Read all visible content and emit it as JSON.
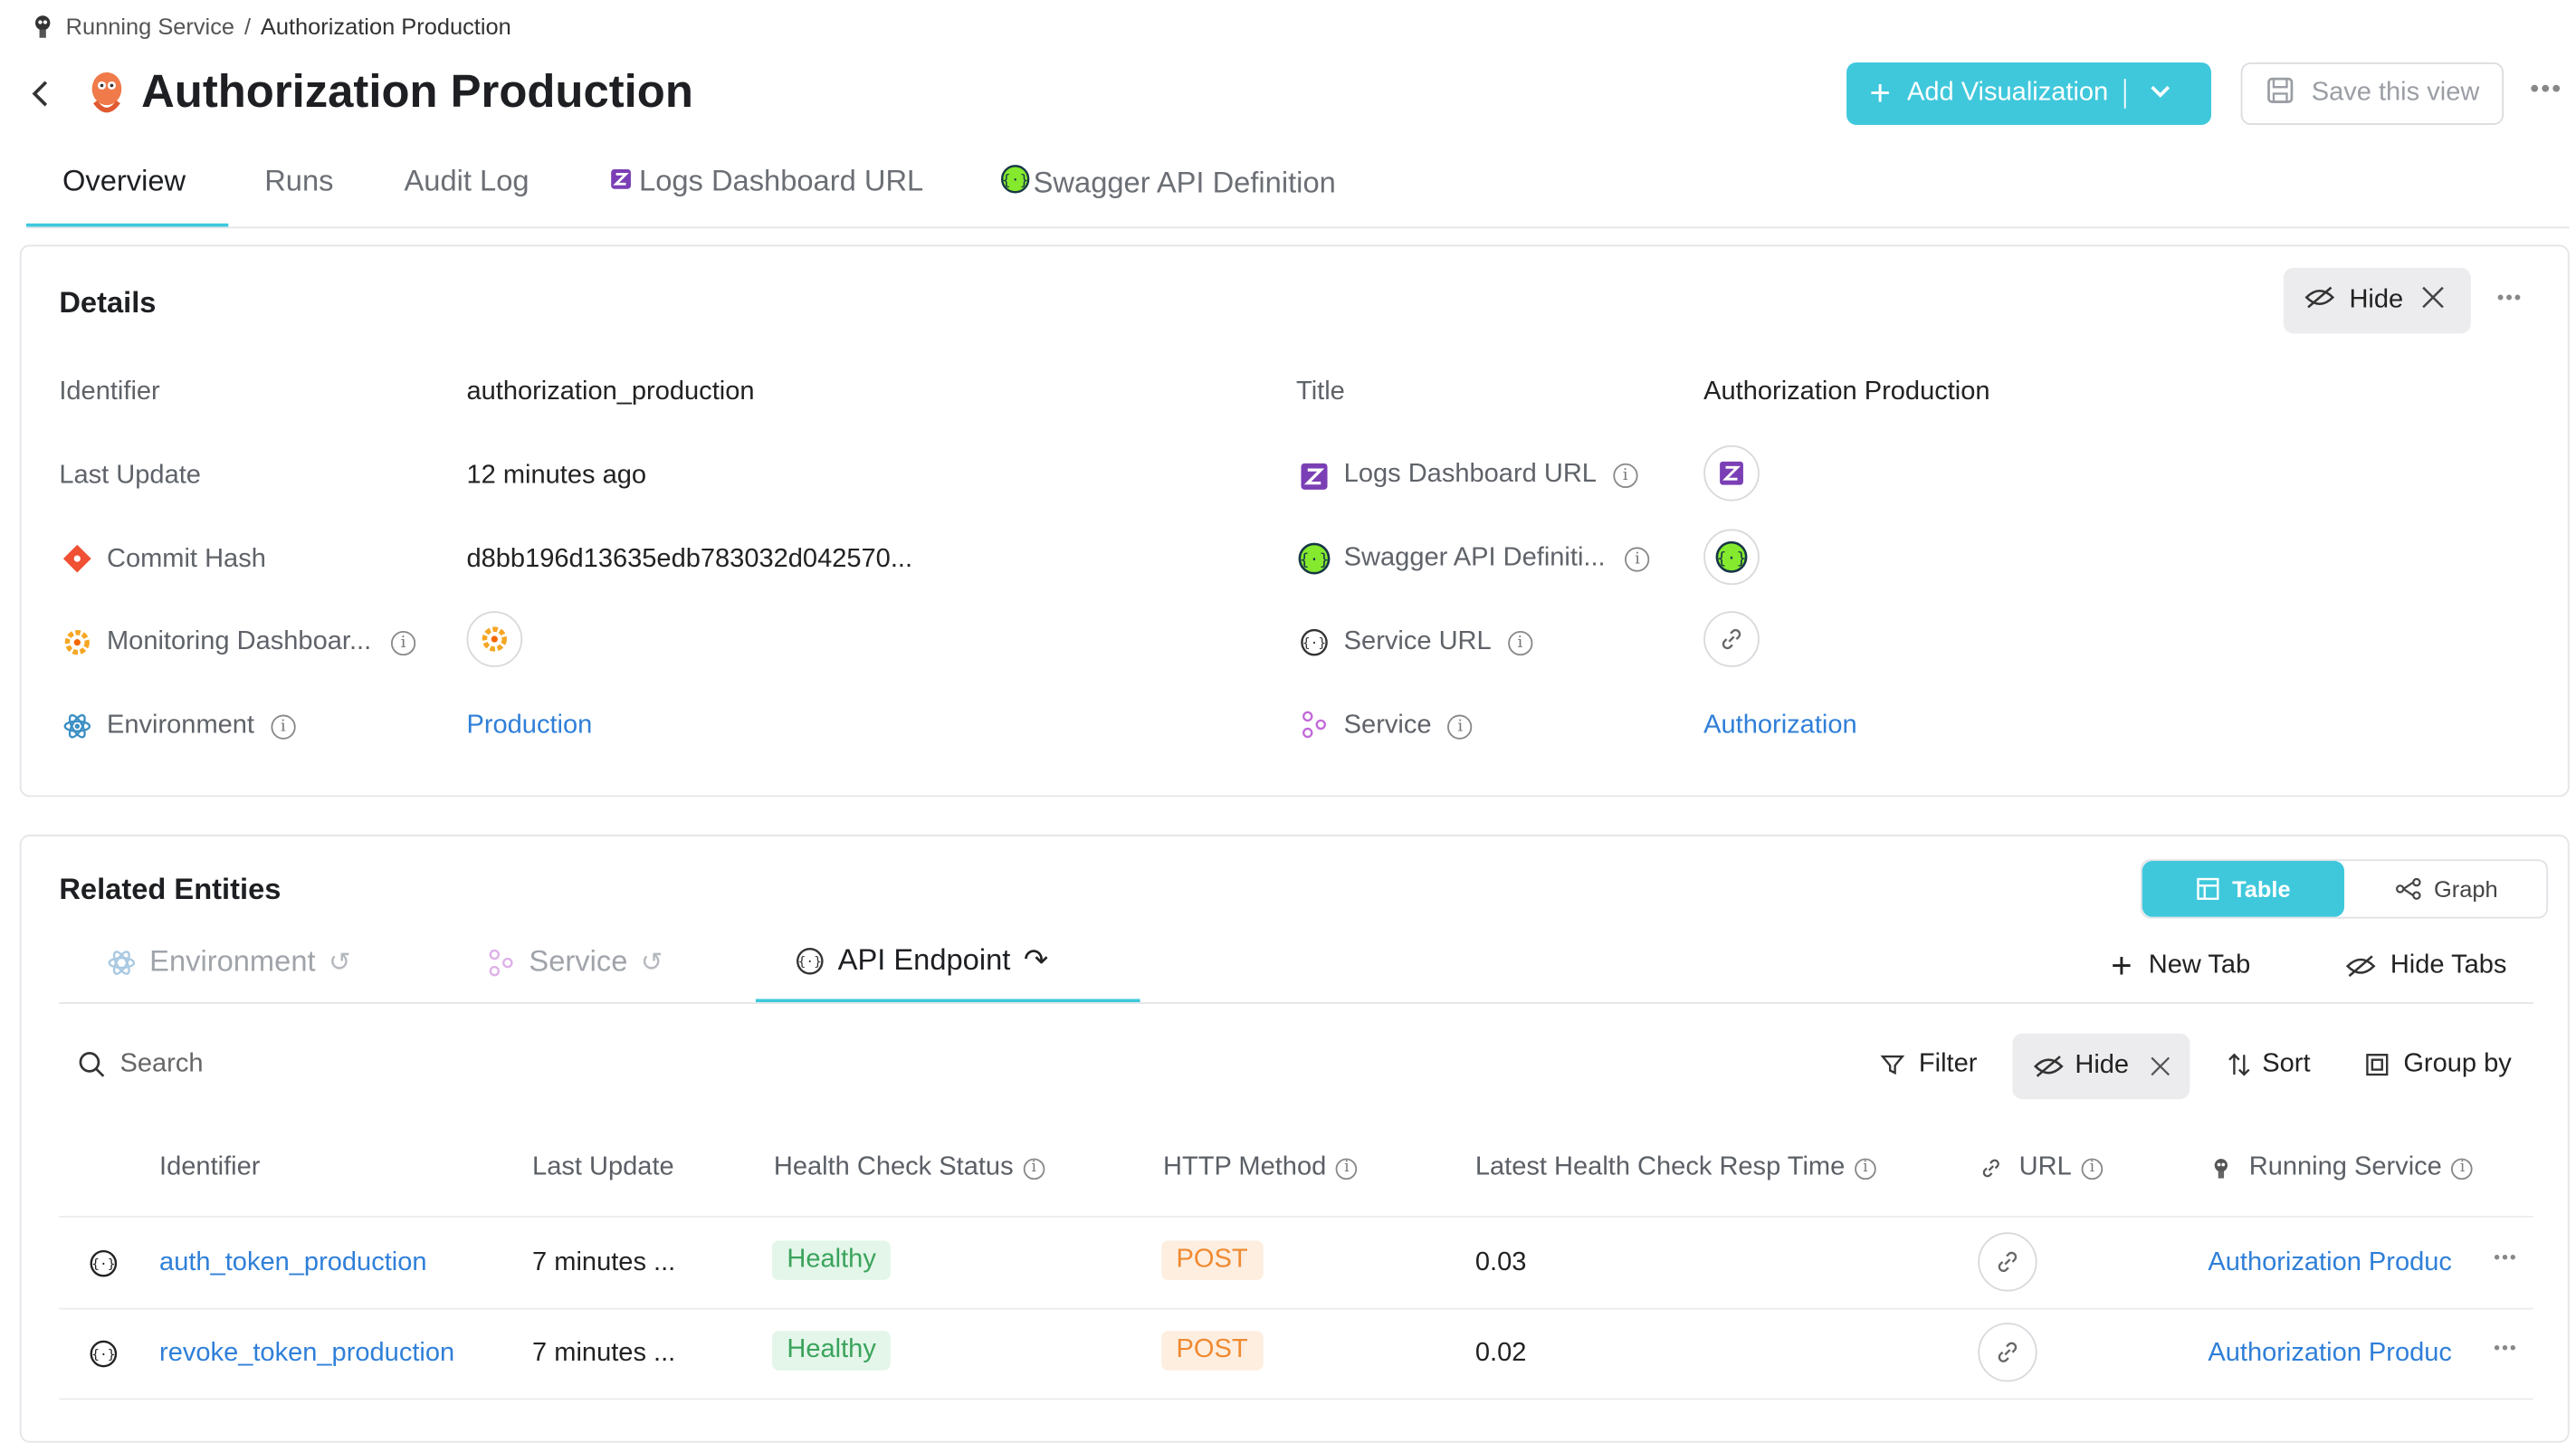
{
  "breadcrumb": {
    "parent": "Running Service",
    "separator": "/",
    "current": "Authorization Production"
  },
  "header": {
    "title": "Authorization Production",
    "add_viz_label": "Add Visualization",
    "save_view_label": "Save this view"
  },
  "tabs": [
    "Overview",
    "Runs",
    "Audit Log",
    "Logs Dashboard URL",
    "Swagger API Definition"
  ],
  "details": {
    "title": "Details",
    "hide_label": "Hide",
    "left": [
      {
        "label": "Identifier",
        "value": "authorization_production"
      },
      {
        "label": "Last Update",
        "value": "12 minutes ago"
      },
      {
        "label": "Commit Hash",
        "value": "d8bb196d13635edb783032d042570..."
      },
      {
        "label": "Monitoring Dashboar..."
      },
      {
        "label": "Environment",
        "value": "Production"
      }
    ],
    "right": [
      {
        "label": "Title",
        "value": "Authorization Production"
      },
      {
        "label": "Logs Dashboard URL"
      },
      {
        "label": "Swagger API Definiti..."
      },
      {
        "label": "Service URL"
      },
      {
        "label": "Service",
        "value": "Authorization"
      }
    ]
  },
  "related": {
    "title": "Related Entities",
    "view_table": "Table",
    "view_graph": "Graph",
    "tabs": [
      "Environment",
      "Service",
      "API Endpoint"
    ],
    "new_tab": "New Tab",
    "hide_tabs": "Hide Tabs",
    "search_placeholder": "Search",
    "toolbar": {
      "filter": "Filter",
      "hide": "Hide",
      "sort": "Sort",
      "group_by": "Group by"
    },
    "columns": [
      "Identifier",
      "Last Update",
      "Health Check Status",
      "HTTP Method",
      "Latest Health Check Resp Time",
      "URL",
      "Running Service"
    ],
    "rows": [
      {
        "identifier": "auth_token_production",
        "last_update": "7 minutes ...",
        "health": "Healthy",
        "method": "POST",
        "resp_time": "0.03",
        "running_service": "Authorization Produc"
      },
      {
        "identifier": "revoke_token_production",
        "last_update": "7 minutes ...",
        "health": "Healthy",
        "method": "POST",
        "resp_time": "0.02",
        "running_service": "Authorization Produc"
      }
    ]
  },
  "colors": {
    "accent": "#3fc8dc",
    "link": "#2f7fd8",
    "healthy_bg": "#e3f6e9",
    "healthy_fg": "#3aa35c",
    "post_bg": "#fdeee0",
    "post_fg": "#ef8a31"
  }
}
